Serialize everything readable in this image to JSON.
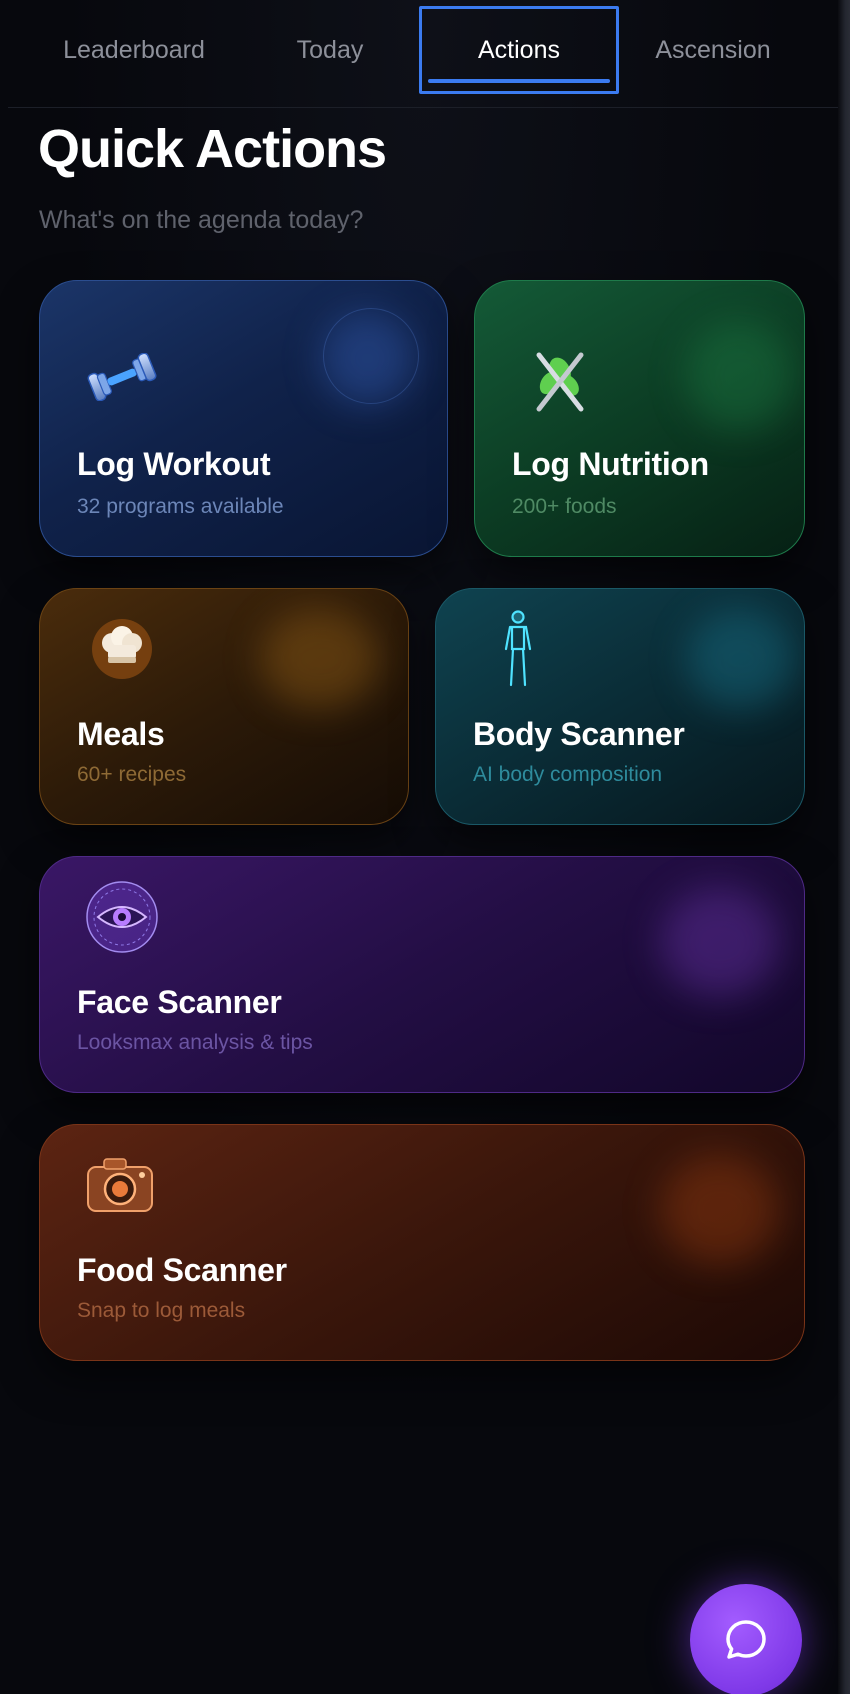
{
  "tabs": [
    {
      "label": "Leaderboard",
      "active": false
    },
    {
      "label": "Today",
      "active": false
    },
    {
      "label": "Actions",
      "active": true
    },
    {
      "label": "Ascension",
      "active": false
    }
  ],
  "header": {
    "title": "Quick Actions",
    "subtitle": "What's on the agenda today?"
  },
  "cards": {
    "workout": {
      "title": "Log Workout",
      "subtitle": "32 programs available",
      "icon": "dumbbell-icon",
      "accent": "#3b6fd6"
    },
    "nutrition": {
      "title": "Log Nutrition",
      "subtitle": "200+ foods",
      "icon": "fork-knife-leaf-icon",
      "accent": "#2fa865"
    },
    "meals": {
      "title": "Meals",
      "subtitle": "60+ recipes",
      "icon": "chef-hat-icon",
      "accent": "#c8861f"
    },
    "body": {
      "title": "Body Scanner",
      "subtitle": "AI body composition",
      "icon": "body-scan-icon",
      "accent": "#2fb0c8"
    },
    "face": {
      "title": "Face Scanner",
      "subtitle": "Looksmax analysis & tips",
      "icon": "eye-scan-icon",
      "accent": "#9a5cf0"
    },
    "food": {
      "title": "Food Scanner",
      "subtitle": "Snap to log meals",
      "icon": "camera-icon",
      "accent": "#e0703a"
    }
  },
  "fab": {
    "icon": "chat-bubble-icon",
    "color": "#8a44f0"
  }
}
